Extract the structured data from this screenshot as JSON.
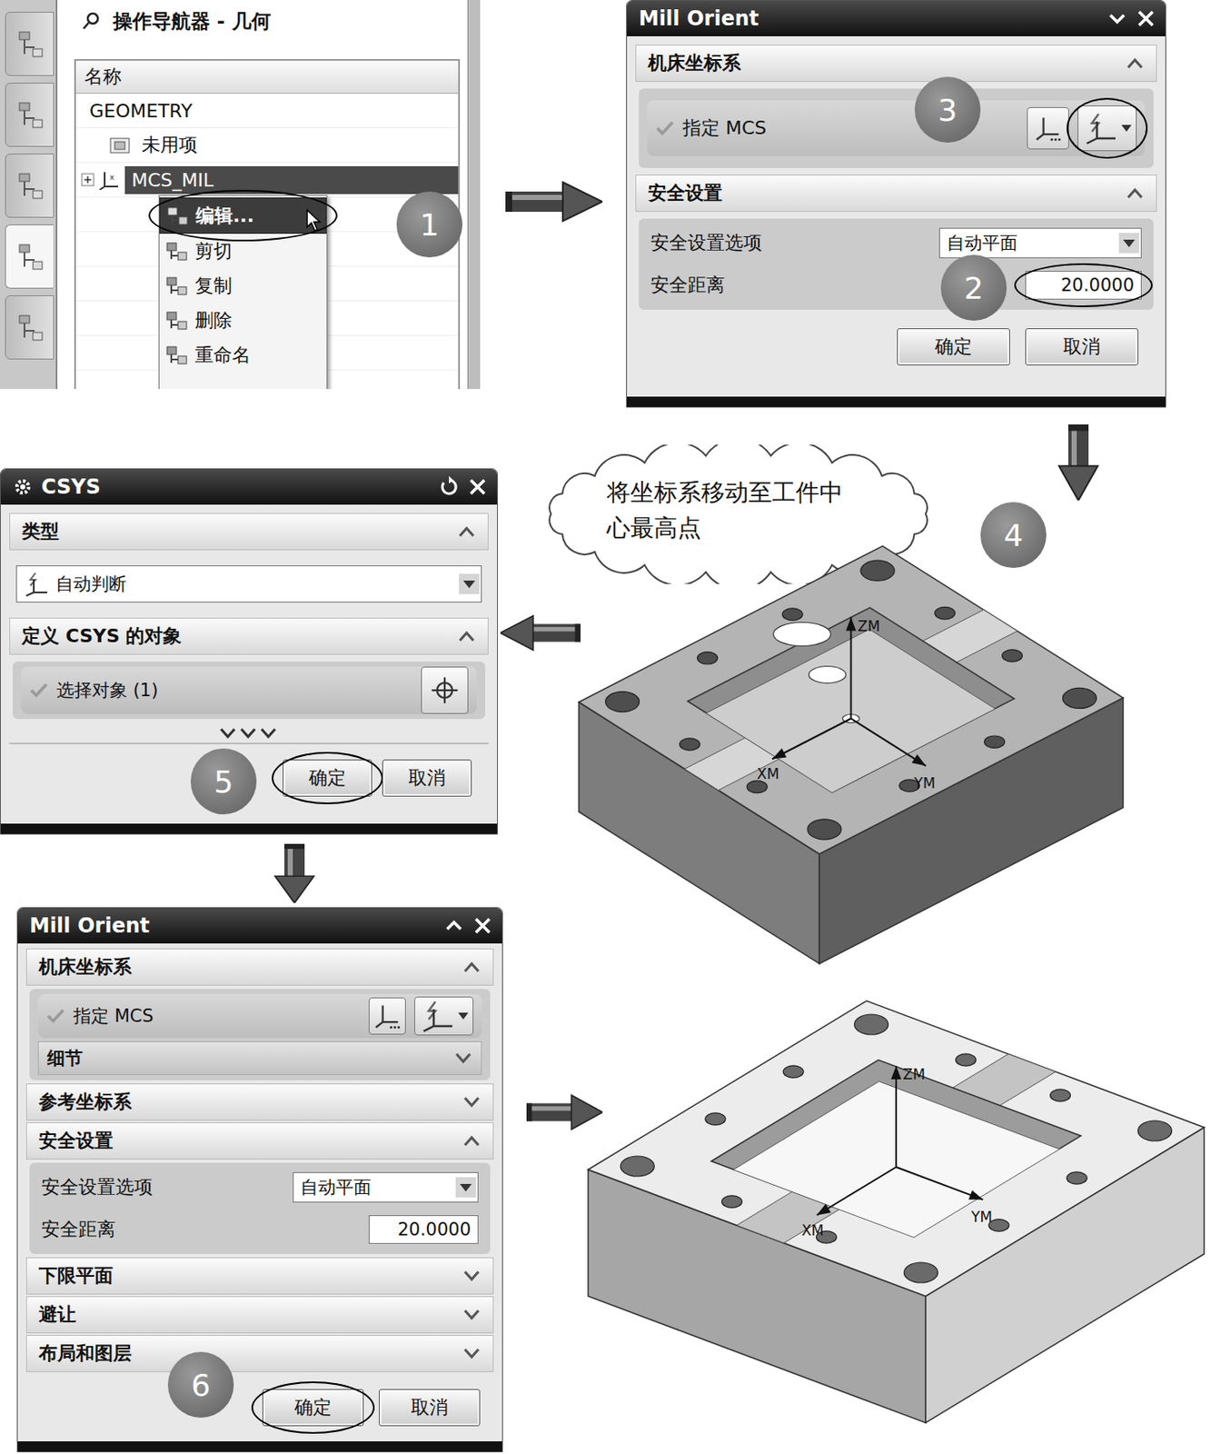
{
  "navigator": {
    "title": "操作导航器 - 几何",
    "column": "名称",
    "resource_tabs": [
      {
        "selected": false
      },
      {
        "selected": false
      },
      {
        "selected": false
      },
      {
        "selected": true
      },
      {
        "selected": false
      }
    ],
    "rows": [
      {
        "label": "GEOMETRY",
        "kind": "root",
        "selected": false
      },
      {
        "label": "未用项",
        "kind": "folder",
        "selected": false
      },
      {
        "label": "MCS_MIL",
        "kind": "mcs",
        "selected": true
      }
    ]
  },
  "context_menu": {
    "items": [
      {
        "label": "编辑...",
        "selected": true,
        "circled": true
      },
      {
        "label": "剪切",
        "selected": false,
        "circled": false
      },
      {
        "label": "复制",
        "selected": false,
        "circled": false
      },
      {
        "label": "删除",
        "selected": false,
        "circled": false
      },
      {
        "label": "重命名",
        "selected": false,
        "circled": false
      }
    ]
  },
  "mill_orient_top": {
    "title": "Mill Orient",
    "mcs_section": {
      "label": "机床坐标系",
      "expanded": true
    },
    "specify_mcs": {
      "label": "指定 MCS",
      "checked": true,
      "picker_circled": true
    },
    "clearance_section": {
      "label": "安全设置",
      "expanded": true
    },
    "clearance_option": {
      "label": "安全设置选项",
      "value": "自动平面"
    },
    "clearance_distance": {
      "label": "安全距离",
      "value": "20.0000",
      "circled": true
    },
    "buttons": [
      {
        "label": "确定",
        "circled": false
      },
      {
        "label": "取消",
        "circled": false
      }
    ]
  },
  "callout": {
    "text": "将坐标系移动至工件中心最高点"
  },
  "csys": {
    "title": "CSYS",
    "type_section": {
      "label": "类型",
      "expanded": true
    },
    "type_value": "自动判断",
    "object_section": {
      "label": "定义 CSYS 的对象",
      "expanded": true
    },
    "select_object": {
      "label": "选择对象 (1)",
      "checked": true
    },
    "buttons": [
      {
        "label": "确定",
        "circled": true
      },
      {
        "label": "取消",
        "circled": false
      }
    ]
  },
  "mill_orient_bottom": {
    "title": "Mill Orient",
    "mcs_section": {
      "label": "机床坐标系",
      "expanded": true
    },
    "specify_mcs": {
      "label": "指定 MCS",
      "checked": true
    },
    "details": {
      "label": "细节",
      "expanded": false
    },
    "sections_before": [
      {
        "label": "参考坐标系",
        "expanded": false
      }
    ],
    "clearance_section": {
      "label": "安全设置",
      "expanded": true
    },
    "clearance_option": {
      "label": "安全设置选项",
      "value": "自动平面"
    },
    "clearance_distance": {
      "label": "安全距离",
      "value": "20.0000"
    },
    "sections_after": [
      {
        "label": "下限平面",
        "expanded": false
      },
      {
        "label": "避让",
        "expanded": false
      },
      {
        "label": "布局和图层",
        "expanded": false
      }
    ],
    "buttons": [
      {
        "label": "确定",
        "circled": true
      },
      {
        "label": "取消",
        "circled": false
      }
    ]
  },
  "parts": [
    {
      "axes": [
        "ZM",
        "XM",
        "YM"
      ],
      "markers": true
    },
    {
      "axes": [
        "ZM",
        "XM",
        "YM"
      ],
      "markers": false
    }
  ],
  "steps": [
    "1",
    "2",
    "3",
    "4",
    "5",
    "6"
  ]
}
